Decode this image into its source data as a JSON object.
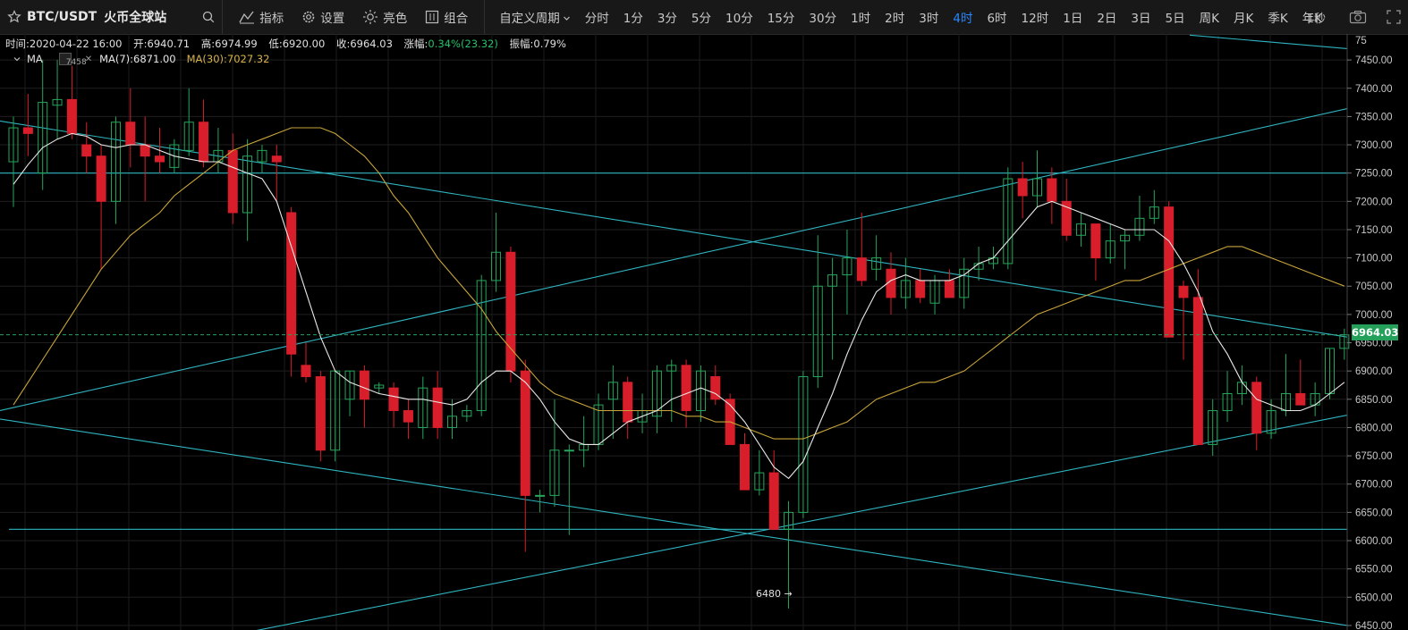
{
  "header": {
    "symbol": "BTC/USDT",
    "exchange": "火币全球站",
    "tools": [
      {
        "label": "指标",
        "icon": "indicator-icon"
      },
      {
        "label": "设置",
        "icon": "gear-icon"
      },
      {
        "label": "亮色",
        "icon": "sun-icon"
      },
      {
        "label": "组合",
        "icon": "layout-icon"
      }
    ],
    "custom_period": "自定义周期",
    "periods": [
      "分时",
      "1分",
      "3分",
      "5分",
      "10分",
      "15分",
      "30分",
      "1时",
      "2时",
      "3时",
      "4时",
      "6时",
      "12时",
      "1日",
      "2日",
      "3日",
      "5日",
      "周K",
      "月K",
      "季K",
      "年K"
    ],
    "active_period": "4时",
    "refresh": "1秒"
  },
  "info": {
    "time": "时间:2020-04-22 16:00",
    "open": "开:6940.71",
    "high": "高:6974.99",
    "low": "低:6920.00",
    "close": "收:6964.03",
    "change_label": "涨幅:",
    "change_value": "0.34%(23.32)",
    "amplitude": "振幅:0.79%"
  },
  "ma": {
    "label": "MA",
    "badge": "7458",
    "ma7": "MA(7):6871.00",
    "ma30": "MA(30):7027.32"
  },
  "colors": {
    "up": "#26a65b",
    "down": "#d81e2a",
    "ma7": "#e8e8e8",
    "ma30": "#c9a43a",
    "trend": "#2fb4bf",
    "active": "#2a86ff",
    "price_tag": "#25a05a"
  },
  "price_axis": {
    "labels": [
      "7450.00",
      "7400.00",
      "7350.00",
      "7300.00",
      "7250.00",
      "7200.00",
      "7150.00",
      "7100.00",
      "7050.00",
      "7000.00",
      "6950.00",
      "6900.00",
      "6850.00",
      "6800.00",
      "6750.00",
      "6700.00",
      "6650.00",
      "6600.00",
      "6550.00",
      "6500.00",
      "6450.00"
    ],
    "top_partial": "75",
    "current_price": "6964.03"
  },
  "low_marker": "6480 →",
  "chart_data": {
    "type": "candlestick",
    "timeframe": "4h",
    "ylim": [
      6442,
      7496
    ],
    "ohlc": [
      [
        7270,
        7350,
        7190,
        7330
      ],
      [
        7330,
        7390,
        7280,
        7320
      ],
      [
        7250,
        7450,
        7220,
        7375
      ],
      [
        7370,
        7450,
        7310,
        7380
      ],
      [
        7380,
        7440,
        7310,
        7320
      ],
      [
        7300,
        7340,
        7250,
        7280
      ],
      [
        7280,
        7300,
        7080,
        7200
      ],
      [
        7200,
        7350,
        7160,
        7340
      ],
      [
        7340,
        7400,
        7260,
        7300
      ],
      [
        7300,
        7350,
        7200,
        7280
      ],
      [
        7280,
        7330,
        7250,
        7270
      ],
      [
        7260,
        7310,
        7250,
        7300
      ],
      [
        7290,
        7400,
        7280,
        7340
      ],
      [
        7340,
        7380,
        7260,
        7270
      ],
      [
        7270,
        7330,
        7250,
        7290
      ],
      [
        7290,
        7320,
        7160,
        7180
      ],
      [
        7180,
        7310,
        7130,
        7280
      ],
      [
        7270,
        7300,
        7250,
        7290
      ],
      [
        7280,
        7300,
        7200,
        7270
      ],
      [
        7180,
        7190,
        6890,
        6930
      ],
      [
        6910,
        6950,
        6880,
        6890
      ],
      [
        6890,
        6900,
        6740,
        6760
      ],
      [
        6760,
        6900,
        6740,
        6900
      ],
      [
        6850,
        6900,
        6820,
        6900
      ],
      [
        6900,
        6910,
        6800,
        6850
      ],
      [
        6870,
        6880,
        6860,
        6875
      ],
      [
        6870,
        6880,
        6800,
        6830
      ],
      [
        6830,
        6850,
        6780,
        6810
      ],
      [
        6800,
        6890,
        6780,
        6870
      ],
      [
        6870,
        6900,
        6780,
        6800
      ],
      [
        6800,
        6850,
        6780,
        6820
      ],
      [
        6820,
        6840,
        6810,
        6830
      ],
      [
        6830,
        7070,
        6820,
        7060
      ],
      [
        7060,
        7180,
        7040,
        7110
      ],
      [
        7110,
        7120,
        6880,
        6900
      ],
      [
        6900,
        6920,
        6580,
        6680
      ],
      [
        6680,
        6690,
        6650,
        6680
      ],
      [
        6680,
        6850,
        6660,
        6760
      ],
      [
        6760,
        6770,
        6610,
        6760
      ],
      [
        6760,
        6820,
        6730,
        6770
      ],
      [
        6770,
        6860,
        6760,
        6840
      ],
      [
        6850,
        6910,
        6780,
        6880
      ],
      [
        6880,
        6890,
        6780,
        6810
      ],
      [
        6810,
        6860,
        6790,
        6830
      ],
      [
        6820,
        6910,
        6790,
        6900
      ],
      [
        6900,
        6920,
        6810,
        6910
      ],
      [
        6910,
        6920,
        6800,
        6830
      ],
      [
        6830,
        6910,
        6810,
        6900
      ],
      [
        6890,
        6910,
        6840,
        6850
      ],
      [
        6850,
        6860,
        6770,
        6770
      ],
      [
        6770,
        6790,
        6690,
        6690
      ],
      [
        6690,
        6760,
        6680,
        6720
      ],
      [
        6720,
        6760,
        6620,
        6620
      ],
      [
        6620,
        6670,
        6480,
        6650
      ],
      [
        6650,
        6900,
        6640,
        6890
      ],
      [
        6890,
        7140,
        6870,
        7050
      ],
      [
        7050,
        7100,
        6920,
        7070
      ],
      [
        7070,
        7150,
        7000,
        7100
      ],
      [
        7100,
        7180,
        7050,
        7060
      ],
      [
        7080,
        7140,
        7060,
        7100
      ],
      [
        7080,
        7110,
        7000,
        7030
      ],
      [
        7030,
        7100,
        7010,
        7060
      ],
      [
        7060,
        7080,
        7020,
        7030
      ],
      [
        7020,
        7070,
        7000,
        7060
      ],
      [
        7060,
        7080,
        7040,
        7030
      ],
      [
        7030,
        7100,
        7010,
        7080
      ],
      [
        7080,
        7120,
        7060,
        7090
      ],
      [
        7090,
        7120,
        7080,
        7100
      ],
      [
        7090,
        7260,
        7080,
        7240
      ],
      [
        7240,
        7270,
        7170,
        7210
      ],
      [
        7210,
        7290,
        7190,
        7240
      ],
      [
        7240,
        7260,
        7160,
        7200
      ],
      [
        7200,
        7240,
        7130,
        7140
      ],
      [
        7140,
        7180,
        7120,
        7160
      ],
      [
        7160,
        7160,
        7060,
        7100
      ],
      [
        7100,
        7160,
        7090,
        7130
      ],
      [
        7130,
        7150,
        7080,
        7140
      ],
      [
        7140,
        7210,
        7130,
        7170
      ],
      [
        7170,
        7220,
        7160,
        7190
      ],
      [
        7190,
        7200,
        6980,
        6960
      ],
      [
        7050,
        7060,
        6920,
        7030
      ],
      [
        7030,
        7080,
        6770,
        6770
      ],
      [
        6770,
        6850,
        6750,
        6830
      ],
      [
        6830,
        6900,
        6810,
        6860
      ],
      [
        6860,
        6910,
        6840,
        6880
      ],
      [
        6880,
        6890,
        6760,
        6790
      ],
      [
        6790,
        6850,
        6780,
        6830
      ],
      [
        6830,
        6930,
        6820,
        6860
      ],
      [
        6860,
        6920,
        6840,
        6840
      ],
      [
        6840,
        6880,
        6820,
        6860
      ],
      [
        6860,
        6940,
        6850,
        6940
      ],
      [
        6940,
        6975,
        6920,
        6964
      ]
    ],
    "ma7": [
      7230,
      7265,
      7295,
      7310,
      7320,
      7315,
      7300,
      7295,
      7300,
      7300,
      7290,
      7280,
      7275,
      7270,
      7270,
      7260,
      7250,
      7240,
      7200,
      7120,
      7040,
      6960,
      6900,
      6880,
      6870,
      6860,
      6855,
      6850,
      6850,
      6845,
      6840,
      6850,
      6880,
      6900,
      6900,
      6880,
      6850,
      6810,
      6780,
      6770,
      6770,
      6790,
      6810,
      6820,
      6830,
      6850,
      6860,
      6870,
      6860,
      6840,
      6810,
      6770,
      6730,
      6710,
      6740,
      6800,
      6860,
      6930,
      6990,
      7040,
      7060,
      7070,
      7060,
      7060,
      7060,
      7070,
      7090,
      7100,
      7130,
      7160,
      7190,
      7200,
      7190,
      7180,
      7170,
      7160,
      7150,
      7150,
      7150,
      7130,
      7090,
      7040,
      6970,
      6930,
      6880,
      6850,
      6840,
      6830,
      6830,
      6840,
      6860,
      6880
    ],
    "ma30": [
      6840,
      6880,
      6920,
      6960,
      7000,
      7040,
      7080,
      7110,
      7140,
      7160,
      7180,
      7210,
      7230,
      7250,
      7270,
      7290,
      7300,
      7310,
      7320,
      7330,
      7330,
      7330,
      7320,
      7300,
      7280,
      7250,
      7210,
      7180,
      7140,
      7100,
      7070,
      7040,
      7010,
      6970,
      6940,
      6910,
      6880,
      6860,
      6850,
      6840,
      6830,
      6830,
      6830,
      6830,
      6830,
      6830,
      6820,
      6820,
      6810,
      6810,
      6800,
      6790,
      6780,
      6780,
      6780,
      6790,
      6800,
      6810,
      6830,
      6850,
      6860,
      6870,
      6880,
      6880,
      6890,
      6900,
      6920,
      6940,
      6960,
      6980,
      7000,
      7010,
      7020,
      7030,
      7040,
      7050,
      7060,
      7060,
      7070,
      7080,
      7090,
      7100,
      7110,
      7120,
      7120,
      7110,
      7100,
      7090,
      7080,
      7070,
      7060,
      7050
    ],
    "current_price": 6964.03,
    "low_annotation": 6480
  }
}
